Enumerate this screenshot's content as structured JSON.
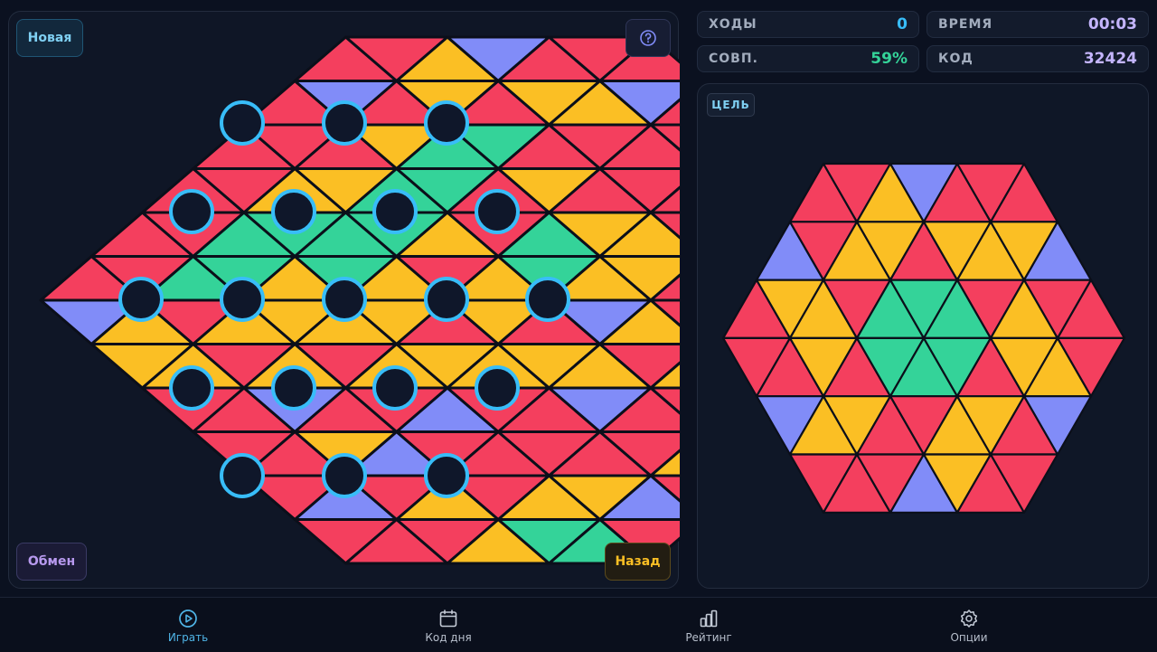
{
  "controls": {
    "new_label": "Новая",
    "swap_label": "Обмен",
    "back_label": "Назад"
  },
  "stats": {
    "moves": {
      "label": "ХОДЫ",
      "value": "0",
      "color": "#38bdf8"
    },
    "time": {
      "label": "ВРЕМЯ",
      "value": "00:03",
      "color": "#c4b5fd"
    },
    "match": {
      "label": "СОВП.",
      "value": "59%",
      "color": "#34d399"
    },
    "code": {
      "label": "КОД",
      "value": "32424",
      "color": "#c4b5fd"
    }
  },
  "target": {
    "label": "ЦЕЛЬ"
  },
  "nav": {
    "active": "play",
    "items": [
      {
        "id": "play",
        "label": "Играть",
        "icon": "play-circle-icon"
      },
      {
        "id": "daily",
        "label": "Код дня",
        "icon": "calendar-icon"
      },
      {
        "id": "rating",
        "label": "Рейтинг",
        "icon": "bar-chart-icon"
      },
      {
        "id": "options",
        "label": "Опции",
        "icon": "gear-icon"
      }
    ]
  },
  "colors": {
    "R": "#f43f5e",
    "Y": "#fbbf24",
    "B": "#818cf8",
    "G": "#34d399",
    "pivot_ring": "#38bdf8",
    "pivot_fill": "#0f172a",
    "accent": "#38bdf8"
  },
  "board": {
    "rows": [
      "RRYBRRR",
      "RBRYRYYB",
      "RRRYGGRRR",
      "RRYYGGRYRR",
      "RRGGGGYRGYYR",
      "RRGGYGYRYGYYR",
      "BYRYYYYRYR",
      "YYRYRYYY",
      "RRBRRB"
    ]
  },
  "goal": {
    "rows": [
      "RRYBRRR",
      "BRYYRYYYB",
      "RYYRGGGRYRR",
      "RRYRGGGRYYR",
      "BYYRRYYRB",
      "RRRBYR"
    ]
  }
}
